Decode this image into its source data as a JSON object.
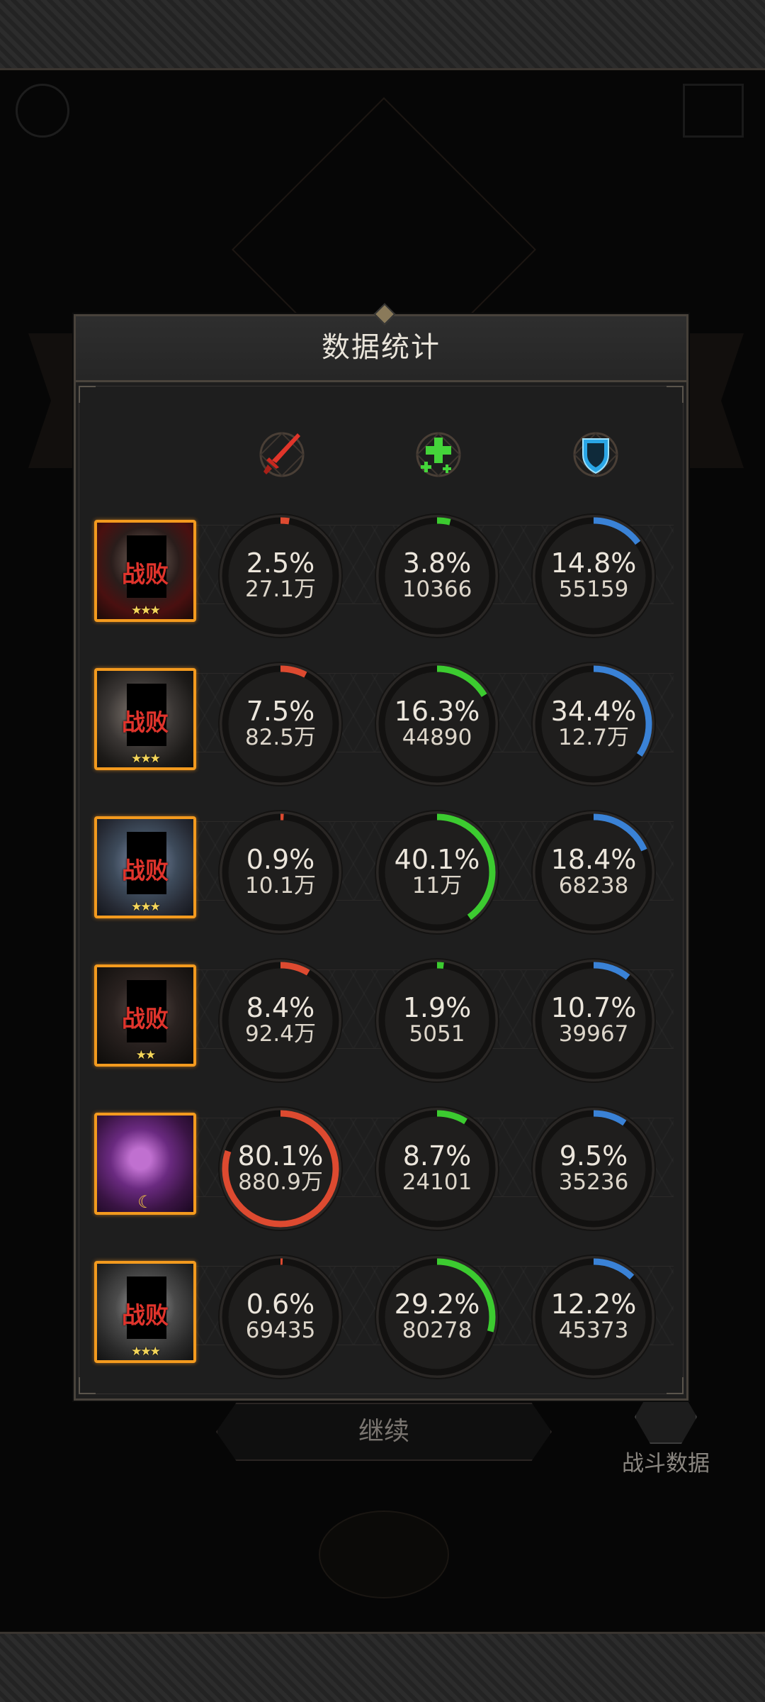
{
  "panel": {
    "title": "数据统计"
  },
  "columns": [
    {
      "key": "damage",
      "icon": "sword-icon",
      "color": "#dd4a30"
    },
    {
      "key": "healing",
      "icon": "heal-cross-icon",
      "color": "#3ccb30"
    },
    {
      "key": "tanking",
      "icon": "shield-icon",
      "color": "#3a82d6"
    }
  ],
  "rows": [
    {
      "status": "战败",
      "stars": "★★★",
      "moon": "",
      "damage": {
        "pct": "2.5%",
        "value": "27.1万",
        "ratio": 0.025
      },
      "healing": {
        "pct": "3.8%",
        "value": "10366",
        "ratio": 0.038
      },
      "tanking": {
        "pct": "14.8%",
        "value": "55159",
        "ratio": 0.148
      }
    },
    {
      "status": "战败",
      "stars": "★★★",
      "moon": "",
      "damage": {
        "pct": "7.5%",
        "value": "82.5万",
        "ratio": 0.075
      },
      "healing": {
        "pct": "16.3%",
        "value": "44890",
        "ratio": 0.163
      },
      "tanking": {
        "pct": "34.4%",
        "value": "12.7万",
        "ratio": 0.344
      }
    },
    {
      "status": "战败",
      "stars": "★★★",
      "moon": "",
      "damage": {
        "pct": "0.9%",
        "value": "10.1万",
        "ratio": 0.009
      },
      "healing": {
        "pct": "40.1%",
        "value": "11万",
        "ratio": 0.401
      },
      "tanking": {
        "pct": "18.4%",
        "value": "68238",
        "ratio": 0.184
      }
    },
    {
      "status": "战败",
      "stars": "★★",
      "moon": "",
      "damage": {
        "pct": "8.4%",
        "value": "92.4万",
        "ratio": 0.084
      },
      "healing": {
        "pct": "1.9%",
        "value": "5051",
        "ratio": 0.019
      },
      "tanking": {
        "pct": "10.7%",
        "value": "39967",
        "ratio": 0.107
      }
    },
    {
      "status": "",
      "stars": "",
      "moon": "☾",
      "damage": {
        "pct": "80.1%",
        "value": "880.9万",
        "ratio": 0.801
      },
      "healing": {
        "pct": "8.7%",
        "value": "24101",
        "ratio": 0.087
      },
      "tanking": {
        "pct": "9.5%",
        "value": "35236",
        "ratio": 0.095
      }
    },
    {
      "status": "战败",
      "stars": "★★★",
      "moon": "",
      "damage": {
        "pct": "0.6%",
        "value": "69435",
        "ratio": 0.006
      },
      "healing": {
        "pct": "29.2%",
        "value": "80278",
        "ratio": 0.292
      },
      "tanking": {
        "pct": "12.2%",
        "value": "45373",
        "ratio": 0.122
      }
    }
  ],
  "continue_label": "继续",
  "battle_data_label": "战斗数据"
}
